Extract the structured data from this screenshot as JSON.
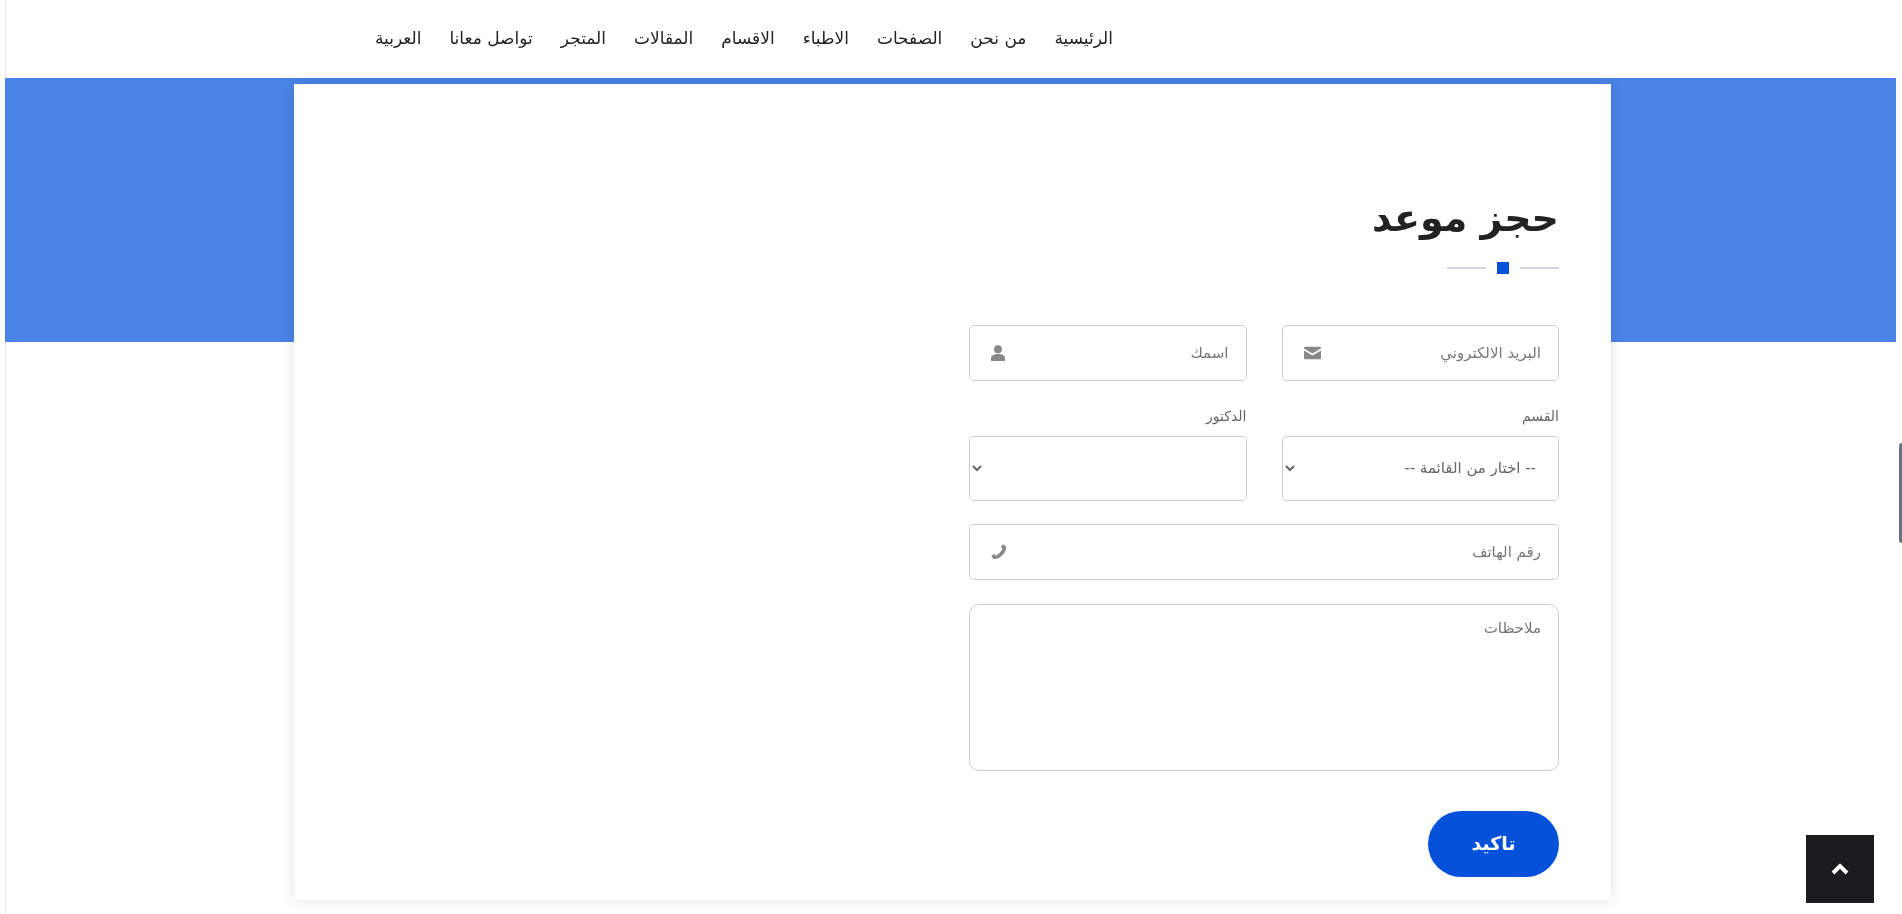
{
  "nav": {
    "items": [
      "الرئيسية",
      "من نحن",
      "الصفحات",
      "الاطباء",
      "الاقسام",
      "المقالات",
      "المتجر",
      "تواصل معانا",
      "العربية"
    ]
  },
  "form": {
    "title": "حجز موعد",
    "fields": [
      {
        "kind": "email",
        "placeholder": "البريد الالكتروني"
      },
      {
        "kind": "name",
        "placeholder": "اسمك"
      },
      {
        "kind": "select",
        "label": "القسم",
        "placeholder": "-- اختار من القائمة --"
      },
      {
        "kind": "select",
        "label": "الدكتور"
      },
      {
        "kind": "phone",
        "placeholder": "رقم الهاتف"
      },
      {
        "kind": "textarea",
        "placeholder": "ملاحظات"
      }
    ],
    "submit": "تاكيد"
  }
}
